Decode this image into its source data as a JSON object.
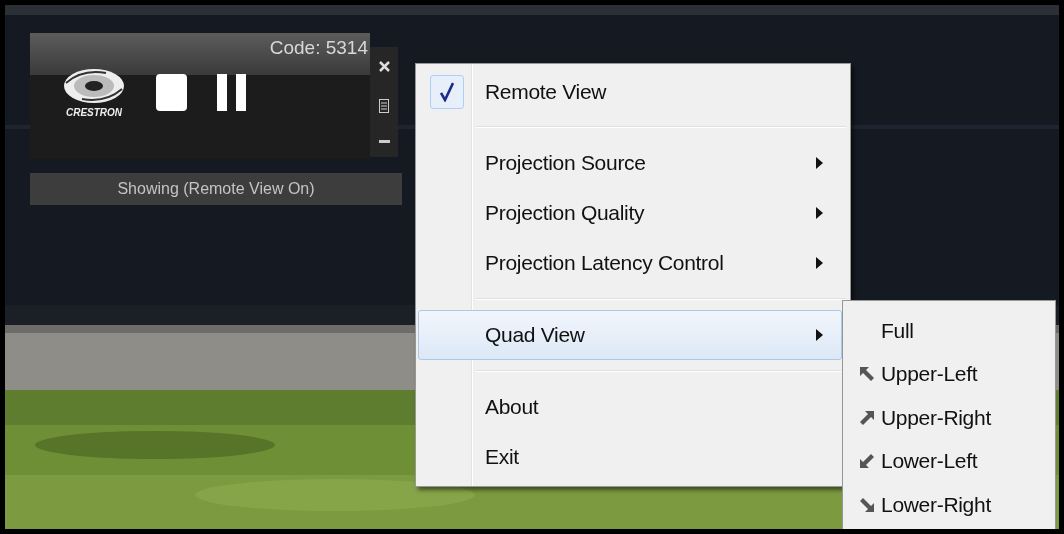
{
  "widget": {
    "code": "Code: 5314",
    "logo_text": "CRESTRON",
    "status": "Showing (Remote View On)"
  },
  "menu": {
    "groups": [
      [
        {
          "kind": "check",
          "label": "Remote View",
          "checked": true,
          "selected": false
        }
      ],
      [
        {
          "kind": "submenu",
          "label": "Projection Source",
          "selected": false
        },
        {
          "kind": "submenu",
          "label": "Projection Quality",
          "selected": false
        },
        {
          "kind": "submenu",
          "label": "Projection Latency Control",
          "selected": false
        }
      ],
      [
        {
          "kind": "submenu",
          "label": "Quad View",
          "selected": true
        }
      ],
      [
        {
          "kind": "plain",
          "label": "About",
          "selected": false
        },
        {
          "kind": "plain",
          "label": "Exit",
          "selected": false
        }
      ]
    ]
  },
  "submenu": {
    "items": [
      {
        "kind": "full",
        "label": "Full",
        "selected": false
      },
      {
        "kind": "upper-left",
        "label": "Upper-Left",
        "selected": false
      },
      {
        "kind": "upper-right",
        "label": "Upper-Right",
        "selected": false
      },
      {
        "kind": "lower-left",
        "label": "Lower-Left",
        "selected": false
      },
      {
        "kind": "lower-right",
        "label": "Lower-Right",
        "selected": false
      }
    ]
  }
}
